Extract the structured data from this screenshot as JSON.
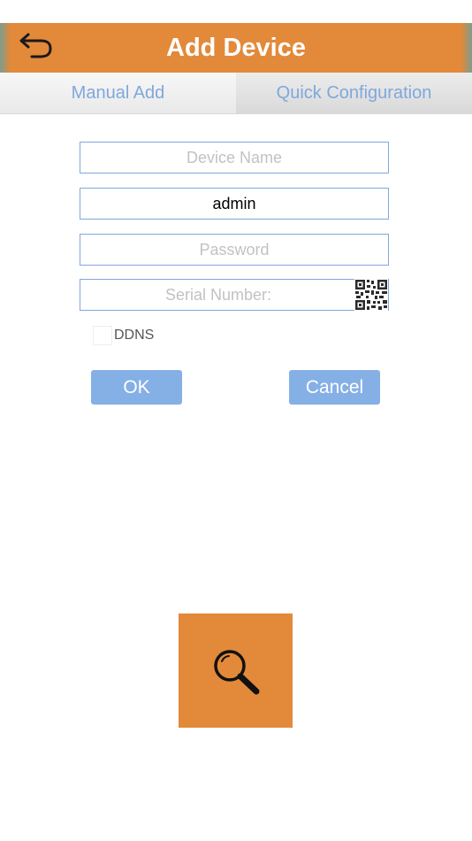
{
  "header": {
    "title": "Add Device"
  },
  "tabs": [
    {
      "label": "Manual Add"
    },
    {
      "label": "Quick Configuration"
    }
  ],
  "form": {
    "device_name": {
      "value": "",
      "placeholder": "Device Name"
    },
    "username": {
      "value": "admin",
      "placeholder": ""
    },
    "password": {
      "value": "",
      "placeholder": "Password"
    },
    "serial": {
      "value": "",
      "placeholder": "Serial Number:"
    },
    "ddns": {
      "label": "DDNS",
      "checked": false
    },
    "ok_label": "OK",
    "cancel_label": "Cancel"
  },
  "colors": {
    "nav_bar": "#e3893a",
    "accent_blue": "#7fa8dc",
    "button_blue": "#85b0e6",
    "search_button": "#e3893a"
  },
  "icons": {
    "back": "back-arrow-icon",
    "qr": "qr-code-icon",
    "search": "magnifier-icon"
  }
}
